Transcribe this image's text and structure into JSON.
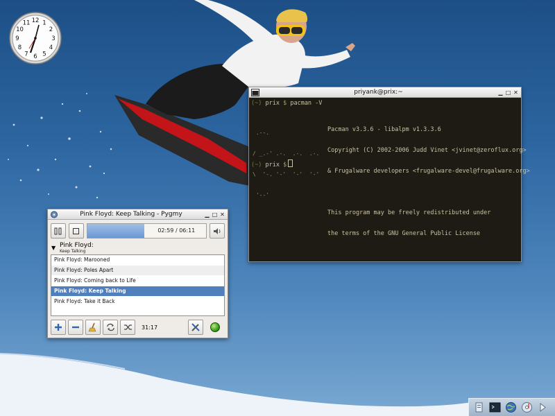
{
  "clock": {
    "numbers": [
      "12",
      "1",
      "2",
      "3",
      "4",
      "5",
      "6",
      "7",
      "8",
      "9",
      "10",
      "11"
    ]
  },
  "terminal": {
    "title": "priyank@prix:~",
    "prompt_dir": "(~)",
    "prompt_host": "prix",
    "prompt_symbol": "$",
    "command": "pacman -V",
    "logo_lines": [
      " .--.",
      "/ _.-' .-.  .-.  .-.",
      "\\  '-. '-'  '-'  '-'",
      " '--'"
    ],
    "output_lines": [
      "Pacman v3.3.6 - libalpm v1.3.3.6",
      "Copyright (C) 2002-2006 Judd Vinet <jvinet@zeroflux.org>",
      "& Frugalware developers <frugalware-devel@frugalware.org>",
      "",
      "This program may be freely redistributed under",
      "the terms of the GNU General Public License"
    ]
  },
  "player": {
    "title": "Pink Floyd: Keep Talking - Pygmy",
    "elapsed": "02:59",
    "separator": "/",
    "total": "06:11",
    "progress_fraction": 0.48,
    "artist": "Pink Floyd:",
    "current_track": "Keep Talking",
    "playlist": [
      {
        "title": "Pink Floyd: Marooned",
        "selected": false
      },
      {
        "title": "Pink Floyd: Poles Apart",
        "selected": false
      },
      {
        "title": "Pink Floyd: Coming back to Life",
        "selected": false
      },
      {
        "title": "Pink Floyd: Keep Talking",
        "selected": true
      },
      {
        "title": "Pink Floyd: Take it Back",
        "selected": false
      }
    ],
    "playlist_duration": "31:17",
    "buttons": [
      "pause-icon",
      "stop-icon",
      "speaker-icon",
      "add-icon",
      "remove-icon",
      "clear-broom-icon",
      "repeat-icon",
      "shuffle-icon",
      "settings-tools-icon",
      "status-green-icon"
    ]
  },
  "tray": {
    "icons": [
      "file-manager-icon",
      "terminal-icon",
      "browser-globe-icon",
      "media-cd-icon",
      "arrow-right-icon"
    ]
  }
}
